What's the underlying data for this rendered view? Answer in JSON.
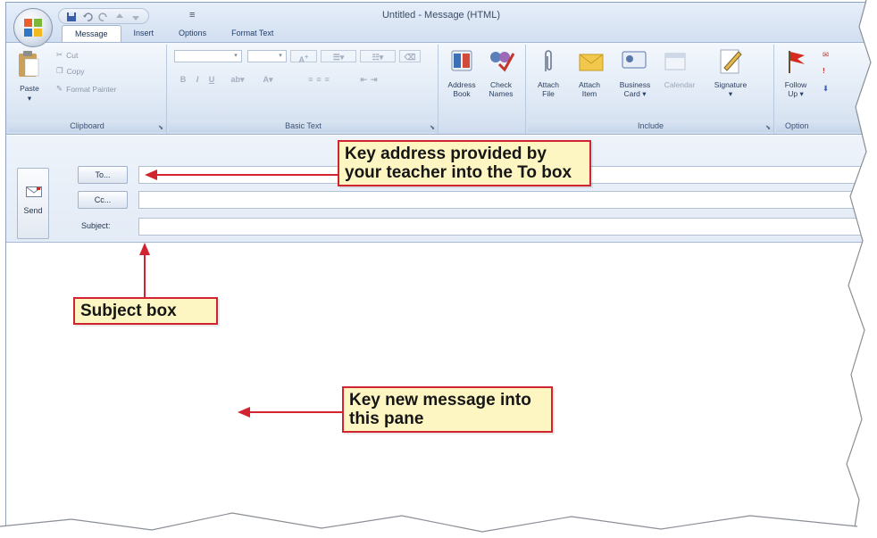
{
  "window": {
    "title": "Untitled - Message (HTML)",
    "qat_more": "≡"
  },
  "tabs": [
    "Message",
    "Insert",
    "Options",
    "Format Text"
  ],
  "ribbon": {
    "clipboard": {
      "label": "Clipboard",
      "paste": "Paste",
      "cut": "Cut",
      "copy": "Copy",
      "format_painter": "Format Painter"
    },
    "basic_text": {
      "label": "Basic Text"
    },
    "names": {
      "address_book": "Address\nBook",
      "check_names": "Check\nNames"
    },
    "include": {
      "label": "Include",
      "attach_file": "Attach\nFile",
      "attach_item": "Attach\nItem",
      "business_card": "Business\nCard ▾",
      "calendar": "Calendar",
      "signature": "Signature\n▾"
    },
    "options": {
      "label": "Option",
      "follow_up": "Follow\nUp ▾"
    }
  },
  "header": {
    "send": "Send",
    "to_button": "To...",
    "cc_button": "Cc...",
    "subject_label": "Subject:"
  },
  "callouts": {
    "to": "Key address provided by your teacher into the To box",
    "subject": "Subject box",
    "body": "Key new message into this pane"
  },
  "colors": {
    "callout_border": "#d12330",
    "callout_fill": "#fdf6c2",
    "ribbon": "#dde7f4"
  }
}
